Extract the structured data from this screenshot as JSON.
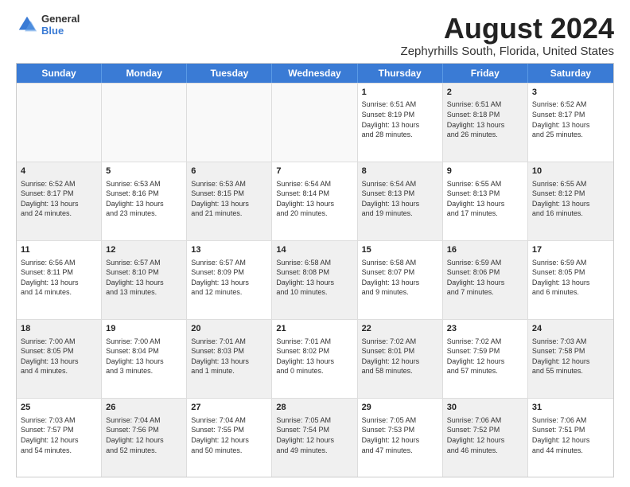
{
  "logo": {
    "line1": "General",
    "line2": "Blue"
  },
  "title": "August 2024",
  "subtitle": "Zephyrhills South, Florida, United States",
  "days": [
    "Sunday",
    "Monday",
    "Tuesday",
    "Wednesday",
    "Thursday",
    "Friday",
    "Saturday"
  ],
  "weeks": [
    [
      {
        "day": "",
        "info": "",
        "shaded": false,
        "empty": true
      },
      {
        "day": "",
        "info": "",
        "shaded": false,
        "empty": true
      },
      {
        "day": "",
        "info": "",
        "shaded": false,
        "empty": true
      },
      {
        "day": "",
        "info": "",
        "shaded": false,
        "empty": true
      },
      {
        "day": "1",
        "info": "Sunrise: 6:51 AM\nSunset: 8:19 PM\nDaylight: 13 hours\nand 28 minutes.",
        "shaded": false,
        "empty": false
      },
      {
        "day": "2",
        "info": "Sunrise: 6:51 AM\nSunset: 8:18 PM\nDaylight: 13 hours\nand 26 minutes.",
        "shaded": true,
        "empty": false
      },
      {
        "day": "3",
        "info": "Sunrise: 6:52 AM\nSunset: 8:17 PM\nDaylight: 13 hours\nand 25 minutes.",
        "shaded": false,
        "empty": false
      }
    ],
    [
      {
        "day": "4",
        "info": "Sunrise: 6:52 AM\nSunset: 8:17 PM\nDaylight: 13 hours\nand 24 minutes.",
        "shaded": true,
        "empty": false
      },
      {
        "day": "5",
        "info": "Sunrise: 6:53 AM\nSunset: 8:16 PM\nDaylight: 13 hours\nand 23 minutes.",
        "shaded": false,
        "empty": false
      },
      {
        "day": "6",
        "info": "Sunrise: 6:53 AM\nSunset: 8:15 PM\nDaylight: 13 hours\nand 21 minutes.",
        "shaded": true,
        "empty": false
      },
      {
        "day": "7",
        "info": "Sunrise: 6:54 AM\nSunset: 8:14 PM\nDaylight: 13 hours\nand 20 minutes.",
        "shaded": false,
        "empty": false
      },
      {
        "day": "8",
        "info": "Sunrise: 6:54 AM\nSunset: 8:13 PM\nDaylight: 13 hours\nand 19 minutes.",
        "shaded": true,
        "empty": false
      },
      {
        "day": "9",
        "info": "Sunrise: 6:55 AM\nSunset: 8:13 PM\nDaylight: 13 hours\nand 17 minutes.",
        "shaded": false,
        "empty": false
      },
      {
        "day": "10",
        "info": "Sunrise: 6:55 AM\nSunset: 8:12 PM\nDaylight: 13 hours\nand 16 minutes.",
        "shaded": true,
        "empty": false
      }
    ],
    [
      {
        "day": "11",
        "info": "Sunrise: 6:56 AM\nSunset: 8:11 PM\nDaylight: 13 hours\nand 14 minutes.",
        "shaded": false,
        "empty": false
      },
      {
        "day": "12",
        "info": "Sunrise: 6:57 AM\nSunset: 8:10 PM\nDaylight: 13 hours\nand 13 minutes.",
        "shaded": true,
        "empty": false
      },
      {
        "day": "13",
        "info": "Sunrise: 6:57 AM\nSunset: 8:09 PM\nDaylight: 13 hours\nand 12 minutes.",
        "shaded": false,
        "empty": false
      },
      {
        "day": "14",
        "info": "Sunrise: 6:58 AM\nSunset: 8:08 PM\nDaylight: 13 hours\nand 10 minutes.",
        "shaded": true,
        "empty": false
      },
      {
        "day": "15",
        "info": "Sunrise: 6:58 AM\nSunset: 8:07 PM\nDaylight: 13 hours\nand 9 minutes.",
        "shaded": false,
        "empty": false
      },
      {
        "day": "16",
        "info": "Sunrise: 6:59 AM\nSunset: 8:06 PM\nDaylight: 13 hours\nand 7 minutes.",
        "shaded": true,
        "empty": false
      },
      {
        "day": "17",
        "info": "Sunrise: 6:59 AM\nSunset: 8:05 PM\nDaylight: 13 hours\nand 6 minutes.",
        "shaded": false,
        "empty": false
      }
    ],
    [
      {
        "day": "18",
        "info": "Sunrise: 7:00 AM\nSunset: 8:05 PM\nDaylight: 13 hours\nand 4 minutes.",
        "shaded": true,
        "empty": false
      },
      {
        "day": "19",
        "info": "Sunrise: 7:00 AM\nSunset: 8:04 PM\nDaylight: 13 hours\nand 3 minutes.",
        "shaded": false,
        "empty": false
      },
      {
        "day": "20",
        "info": "Sunrise: 7:01 AM\nSunset: 8:03 PM\nDaylight: 13 hours\nand 1 minute.",
        "shaded": true,
        "empty": false
      },
      {
        "day": "21",
        "info": "Sunrise: 7:01 AM\nSunset: 8:02 PM\nDaylight: 13 hours\nand 0 minutes.",
        "shaded": false,
        "empty": false
      },
      {
        "day": "22",
        "info": "Sunrise: 7:02 AM\nSunset: 8:01 PM\nDaylight: 12 hours\nand 58 minutes.",
        "shaded": true,
        "empty": false
      },
      {
        "day": "23",
        "info": "Sunrise: 7:02 AM\nSunset: 7:59 PM\nDaylight: 12 hours\nand 57 minutes.",
        "shaded": false,
        "empty": false
      },
      {
        "day": "24",
        "info": "Sunrise: 7:03 AM\nSunset: 7:58 PM\nDaylight: 12 hours\nand 55 minutes.",
        "shaded": true,
        "empty": false
      }
    ],
    [
      {
        "day": "25",
        "info": "Sunrise: 7:03 AM\nSunset: 7:57 PM\nDaylight: 12 hours\nand 54 minutes.",
        "shaded": false,
        "empty": false
      },
      {
        "day": "26",
        "info": "Sunrise: 7:04 AM\nSunset: 7:56 PM\nDaylight: 12 hours\nand 52 minutes.",
        "shaded": true,
        "empty": false
      },
      {
        "day": "27",
        "info": "Sunrise: 7:04 AM\nSunset: 7:55 PM\nDaylight: 12 hours\nand 50 minutes.",
        "shaded": false,
        "empty": false
      },
      {
        "day": "28",
        "info": "Sunrise: 7:05 AM\nSunset: 7:54 PM\nDaylight: 12 hours\nand 49 minutes.",
        "shaded": true,
        "empty": false
      },
      {
        "day": "29",
        "info": "Sunrise: 7:05 AM\nSunset: 7:53 PM\nDaylight: 12 hours\nand 47 minutes.",
        "shaded": false,
        "empty": false
      },
      {
        "day": "30",
        "info": "Sunrise: 7:06 AM\nSunset: 7:52 PM\nDaylight: 12 hours\nand 46 minutes.",
        "shaded": true,
        "empty": false
      },
      {
        "day": "31",
        "info": "Sunrise: 7:06 AM\nSunset: 7:51 PM\nDaylight: 12 hours\nand 44 minutes.",
        "shaded": false,
        "empty": false
      }
    ]
  ]
}
